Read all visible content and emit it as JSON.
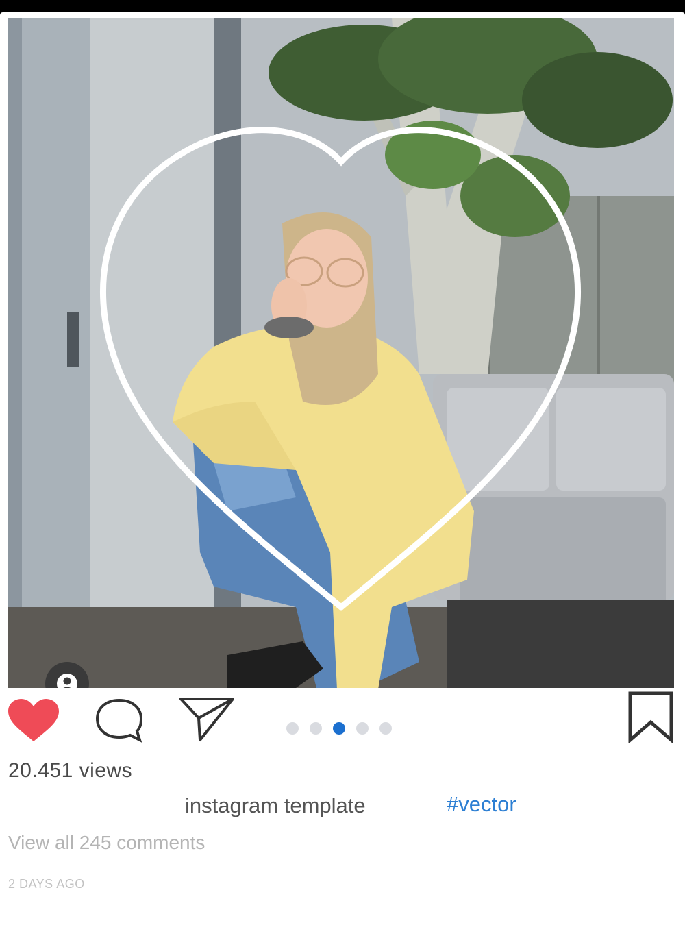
{
  "post": {
    "image": {
      "description_icon": "user-icon",
      "heart_overlay": "heart-outline"
    },
    "actions": {
      "like_icon": "heart-filled-icon",
      "like_color": "#ef4b57",
      "comment_icon": "comment-bubble-icon",
      "share_icon": "paper-plane-icon",
      "save_icon": "bookmark-icon"
    },
    "carousel": {
      "count": 5,
      "active_index": 2,
      "active_color": "#1b6fcf"
    },
    "views": "20.451 views",
    "caption": "instagram template",
    "hashtag": "#vector",
    "hashtag_color": "#2d7fd3",
    "comments_link": "View all 245 comments",
    "timestamp": "2 DAYS AGO"
  }
}
